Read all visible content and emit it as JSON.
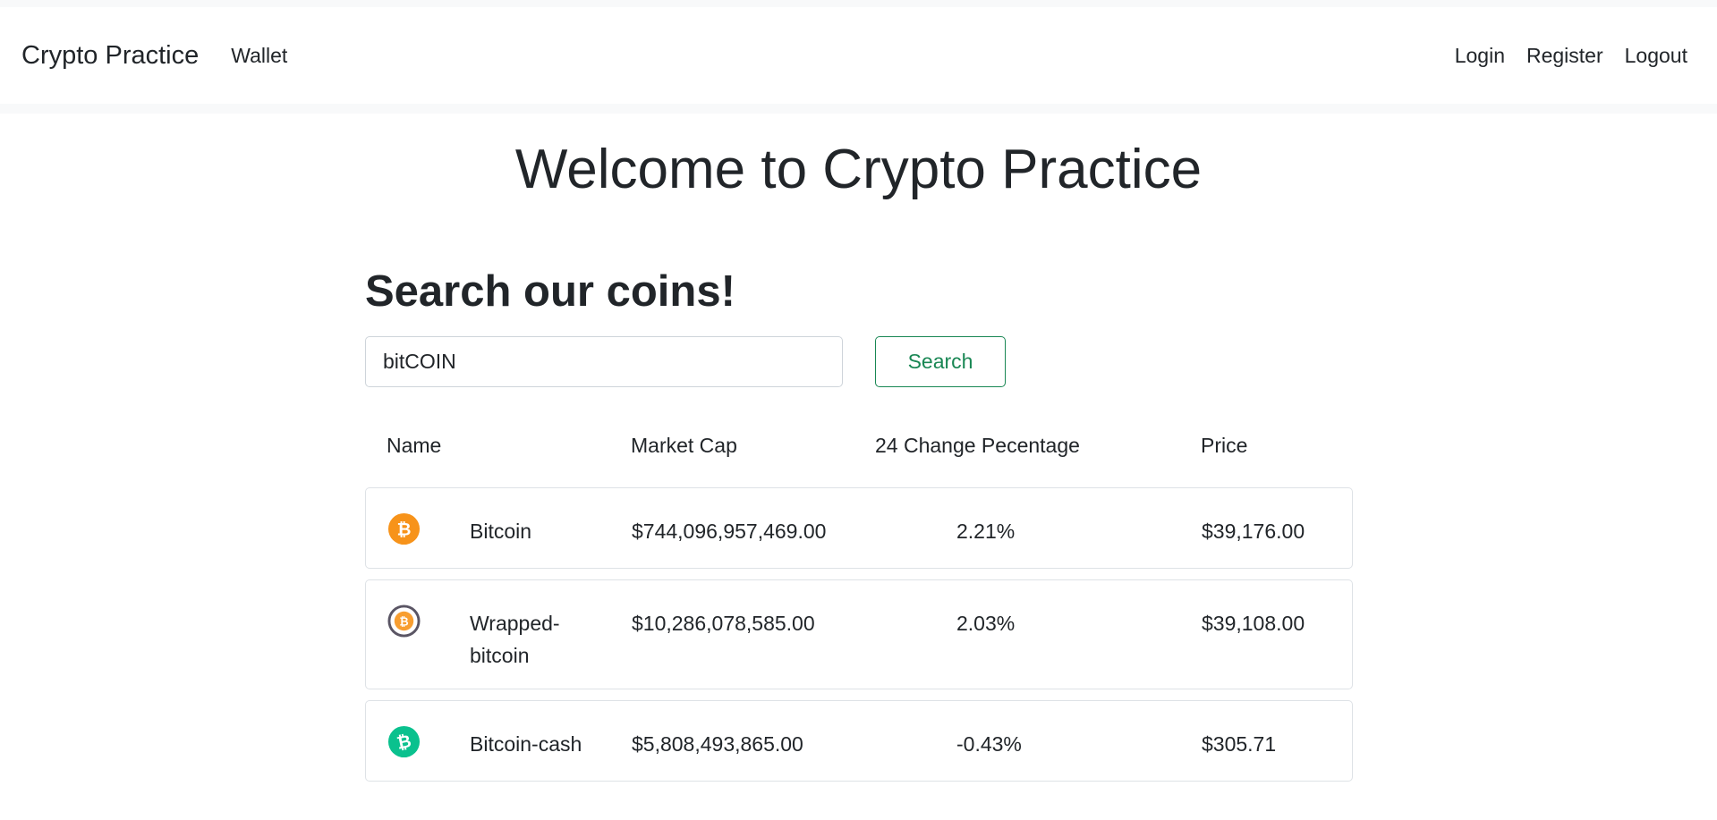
{
  "navbar": {
    "brand": "Crypto Practice",
    "wallet": "Wallet",
    "login": "Login",
    "register": "Register",
    "logout": "Logout"
  },
  "main": {
    "welcome": "Welcome to Crypto Practice",
    "search_title": "Search our coins!",
    "search_value": "bitCOIN",
    "search_button": "Search"
  },
  "table": {
    "headers": [
      "Name",
      "Market Cap",
      "24 Change Pecentage",
      "Price"
    ],
    "rows": [
      {
        "icon": "bitcoin-icon",
        "name": "Bitcoin",
        "market_cap": "$744,096,957,469.00",
        "change": "2.21%",
        "price": "$39,176.00"
      },
      {
        "icon": "wrapped-bitcoin-icon",
        "name_line1": "Wrapped-",
        "name_line2": "bitcoin",
        "market_cap": "$10,286,078,585.00",
        "change": "2.03%",
        "price": "$39,108.00"
      },
      {
        "icon": "bitcoin-cash-icon",
        "name": "Bitcoin-cash",
        "market_cap": "$5,808,493,865.00",
        "change": "-0.43%",
        "price": "$305.71"
      }
    ]
  },
  "colors": {
    "accent": "#198754",
    "bitcoin": "#f7931a",
    "bitcoin_cash": "#0ac18e",
    "wrapped_ring": "#5a5564"
  }
}
